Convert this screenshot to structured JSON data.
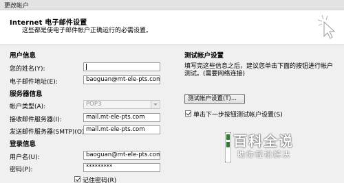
{
  "window": {
    "title": "更改帐户"
  },
  "header": {
    "title": "Internet 电子邮件设置",
    "description": "这些都是使电子邮件帐户正确运行的必需设置。"
  },
  "user_info": {
    "heading": "用户信息",
    "name_label": "您的姓名(Y):",
    "name_value": "",
    "email_label": "电子邮件地址(E):",
    "email_value": "baoguan@mt-ele-pts.com"
  },
  "server_info": {
    "heading": "服务器信息",
    "account_type_label": "帐户类型(A):",
    "account_type_value": "POP3",
    "incoming_label": "接收邮件服务器(I):",
    "incoming_value": "mail.mt-ele-pts.com",
    "outgoing_label": "发送邮件服务器(SMTP)(O):",
    "outgoing_value": "mail.mt-ele-pts.com"
  },
  "login_info": {
    "heading": "登录信息",
    "username_label": "用户名(U):",
    "username_value": "baoguan@mt-ele-pts.com",
    "password_label": "密码(P):",
    "password_value": "*********",
    "remember_label": "记住密码(R)",
    "remember_checked": true
  },
  "test_settings": {
    "heading": "测试帐户设置",
    "description_line1": "填写完这些信息之后，建议您单击下面的按钮进行帐户",
    "description_line2": "测试。(需要网络连接)",
    "test_button_label": "测试帐户设置(T)...",
    "next_test_label": "单击下一步按钮测试帐户设置(S)",
    "next_test_checked": true
  },
  "watermark": {
    "brand": "百科全说",
    "tagline": "助你轻松解决"
  }
}
